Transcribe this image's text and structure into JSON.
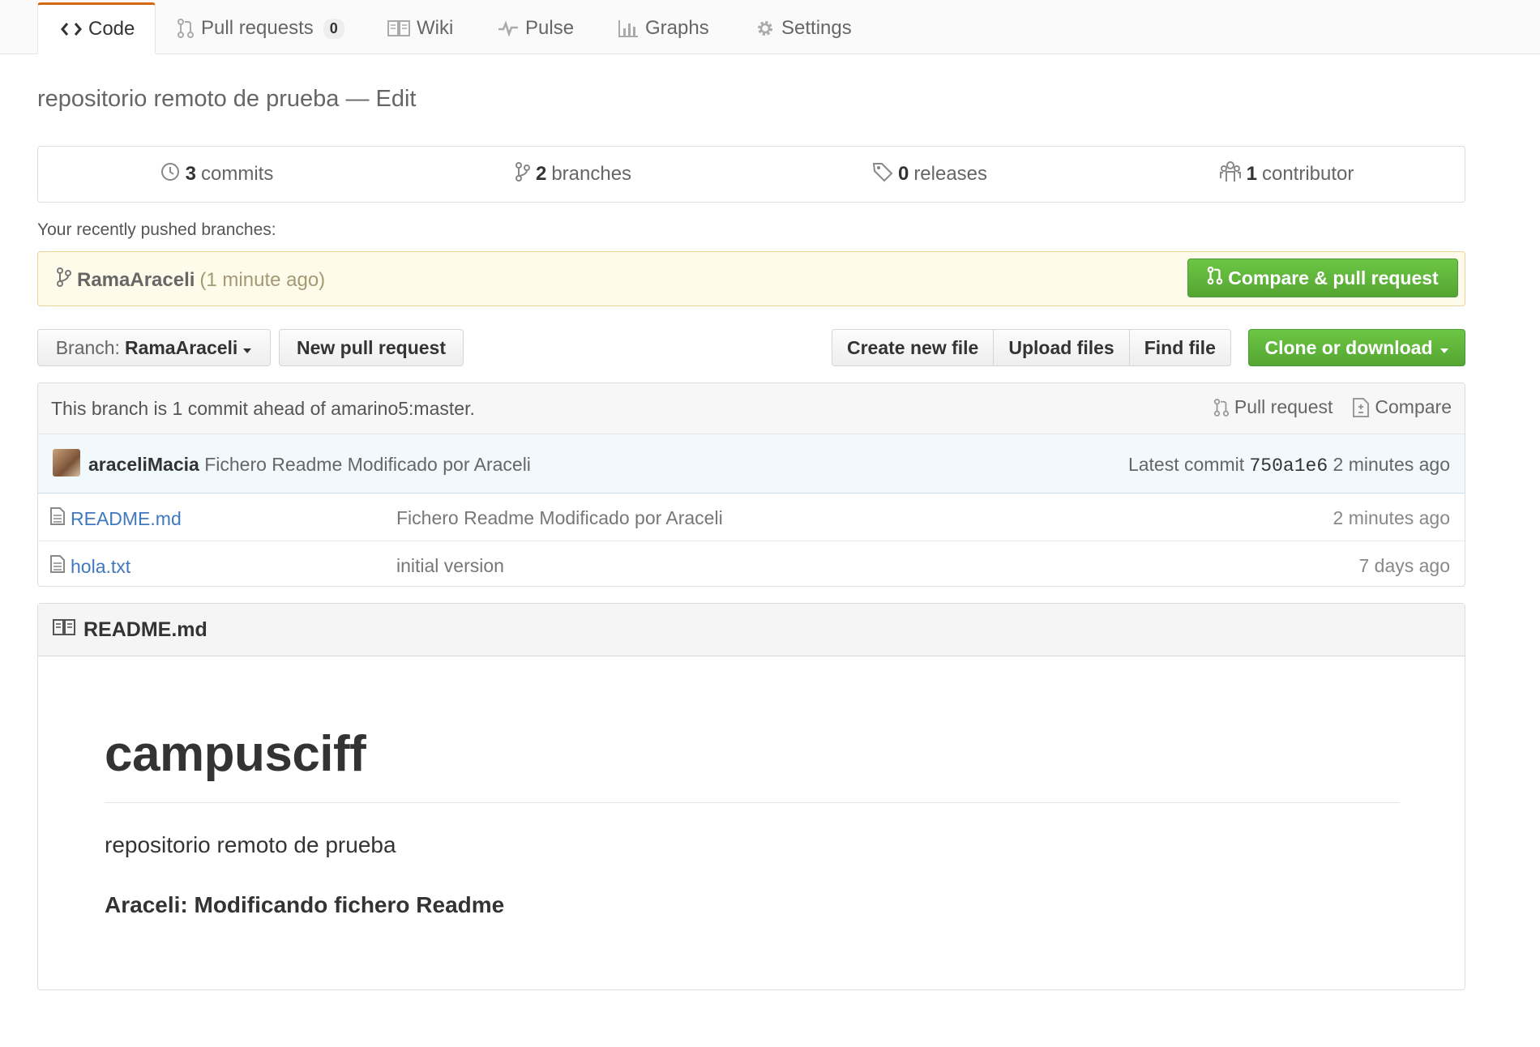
{
  "tabs": [
    {
      "label": "Code",
      "icon": "code-icon"
    },
    {
      "label": "Pull requests",
      "icon": "git-pull-request-icon",
      "count": "0"
    },
    {
      "label": "Wiki",
      "icon": "book-icon"
    },
    {
      "label": "Pulse",
      "icon": "pulse-icon"
    },
    {
      "label": "Graphs",
      "icon": "graph-icon"
    },
    {
      "label": "Settings",
      "icon": "gear-icon"
    }
  ],
  "repo": {
    "description": "repositorio remoto de prueba",
    "separator": "—",
    "edit_label": "Edit"
  },
  "summary": {
    "commits_count": "3",
    "commits_label": "commits",
    "branches_count": "2",
    "branches_label": "branches",
    "releases_count": "0",
    "releases_label": "releases",
    "contributors_count": "1",
    "contributors_label": "contributor"
  },
  "recently_pushed": {
    "label": "Your recently pushed branches:",
    "branch": "RamaAraceli",
    "time": "(1 minute ago)",
    "compare_button": "Compare & pull request"
  },
  "file_nav": {
    "branch_prefix": "Branch:",
    "branch_name": "RamaAraceli",
    "new_pull_request": "New pull request",
    "create_new_file": "Create new file",
    "upload_files": "Upload files",
    "find_file": "Find file",
    "clone_or_download": "Clone or download"
  },
  "branch_info": {
    "message": "This branch is 1 commit ahead of amarino5:master.",
    "pull_request": "Pull request",
    "compare": "Compare"
  },
  "latest_commit": {
    "author": "araceliMacia",
    "message": "Fichero Readme Modificado por Araceli",
    "prefix": "Latest commit",
    "sha": "750a1e6",
    "age": "2 minutes ago"
  },
  "files": [
    {
      "name": "README.md",
      "message": "Fichero Readme Modificado por Araceli",
      "age": "2 minutes ago"
    },
    {
      "name": "hola.txt",
      "message": "initial version",
      "age": "7 days ago"
    }
  ],
  "readme": {
    "filename": "README.md",
    "heading": "campusciff",
    "paragraph": "repositorio remoto de prueba",
    "bold_line": "Araceli: Modificando fichero Readme"
  },
  "colors": {
    "accent_orange": "#d26911",
    "link_blue": "#4078c0",
    "green_button": "#55a532",
    "pushed_bg": "#fffbea"
  }
}
